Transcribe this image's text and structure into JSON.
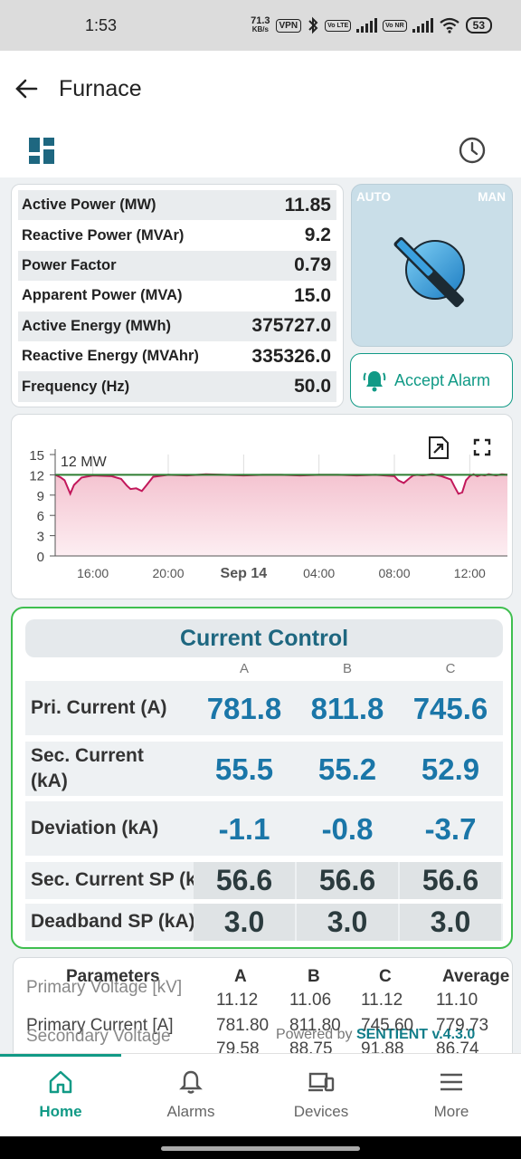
{
  "status": {
    "time": "1:53",
    "net_speed_value": "71.3",
    "net_speed_unit": "KB/s",
    "vpn": "VPN",
    "sim1": "Vo LTE",
    "sim2": "Vo NR",
    "battery": "53"
  },
  "header": {
    "title": "Furnace"
  },
  "power": [
    {
      "label": "Active Power (MW)",
      "value": "11.85"
    },
    {
      "label": "Reactive Power (MVAr)",
      "value": "9.2"
    },
    {
      "label": "Power Factor",
      "value": "0.79"
    },
    {
      "label": "Apparent Power (MVA)",
      "value": "15.0"
    },
    {
      "label": "Active Energy (MWh)",
      "value": "375727.0"
    },
    {
      "label": "Reactive Energy (MVAhr)",
      "value": "335326.0"
    },
    {
      "label": "Frequency (Hz)",
      "value": "50.0"
    }
  ],
  "mode": {
    "auto": "AUTO",
    "man": "MAN"
  },
  "alarm": {
    "label": "Accept Alarm"
  },
  "colors": {
    "accent": "#119a86",
    "value_blue": "#1a76a8",
    "chart_fill": "#f4c3d0",
    "chart_line_red": "#c2185b",
    "chart_line_green": "#2e7d32",
    "card_green_border": "#3fbf4f"
  },
  "chart_data": {
    "type": "area",
    "series_label": "12 MW",
    "y_ticks": [
      "15",
      "12",
      "9",
      "6",
      "3",
      "0"
    ],
    "ylim": [
      0,
      15
    ],
    "x_ticks": [
      {
        "label": "16:00",
        "at": 2
      },
      {
        "label": "20:00",
        "at": 6
      },
      {
        "label": "Sep 14",
        "at": 10
      },
      {
        "label": "04:00",
        "at": 14
      },
      {
        "label": "08:00",
        "at": 18
      },
      {
        "label": "12:00",
        "at": 22
      }
    ],
    "x_range": [
      0,
      24
    ],
    "reference": 12,
    "series": [
      {
        "x": [
          0,
          0.3,
          0.5,
          0.8,
          1.0,
          1.4,
          2,
          3,
          3.5,
          3.8,
          4.0,
          4.3,
          4.6,
          4.8,
          5.2,
          6,
          7,
          8,
          9,
          10,
          11,
          12,
          13,
          14,
          15,
          16,
          17,
          18,
          18.2,
          18.5,
          18.8,
          19,
          19.2,
          19.5,
          20,
          20.5,
          21,
          21.2,
          21.4,
          21.6,
          21.8,
          22,
          22.2,
          22.4,
          22.6,
          22.8,
          23,
          23.4,
          23.7,
          24
        ],
        "y": [
          12,
          11.6,
          11.2,
          9.2,
          10.5,
          11.6,
          11.9,
          11.8,
          11.4,
          10.4,
          9.9,
          10.0,
          9.6,
          10.3,
          11.7,
          12,
          11.9,
          12.1,
          12,
          11.9,
          12,
          12,
          11.9,
          12,
          12,
          11.9,
          12,
          11.8,
          11.2,
          10.8,
          11.5,
          11.9,
          12,
          11.9,
          12.1,
          11.8,
          11.3,
          10.2,
          9.2,
          9.4,
          11.2,
          11.8,
          12.1,
          11.8,
          12.0,
          11.9,
          12.1,
          11.9,
          12.1,
          12.0
        ]
      }
    ]
  },
  "current_control": {
    "title": "Current Control",
    "columns": [
      "A",
      "B",
      "C"
    ],
    "rows": [
      {
        "label": "Pri. Current (A)",
        "values": [
          "781.8",
          "811.8",
          "745.6"
        ]
      },
      {
        "label": "Sec. Current (kA)",
        "values": [
          "55.5",
          "55.2",
          "52.9"
        ]
      },
      {
        "label": "Deviation (kA)",
        "values": [
          "-1.1",
          "-0.8",
          "-3.7"
        ]
      },
      {
        "label": "Sec. Current SP (kA)",
        "values": [
          "56.6",
          "56.6",
          "56.6"
        ]
      },
      {
        "label": "Deadband SP (kA)",
        "values": [
          "3.0",
          "3.0",
          "3.0"
        ]
      }
    ]
  },
  "parameters": {
    "headers": [
      "Parameters",
      "A",
      "B",
      "C",
      "Average"
    ],
    "rows": [
      {
        "label": "Primary Voltage [kV]",
        "values": [
          "11.12",
          "11.06",
          "11.12",
          "11.10"
        ]
      },
      {
        "label": "Primary Current [A]",
        "values": [
          "781.80",
          "811.80",
          "745.60",
          "779.73"
        ]
      },
      {
        "label": "Secondary Voltage",
        "values": [
          "79.58",
          "88.75",
          "91.88",
          "86.74"
        ]
      }
    ]
  },
  "footer": {
    "powered_by": "Powered by",
    "brand": "SENTIENT v.4.3.0"
  },
  "nav": [
    {
      "label": "Home",
      "icon": "home-icon"
    },
    {
      "label": "Alarms",
      "icon": "bell-icon"
    },
    {
      "label": "Devices",
      "icon": "devices-icon"
    },
    {
      "label": "More",
      "icon": "menu-icon"
    }
  ]
}
